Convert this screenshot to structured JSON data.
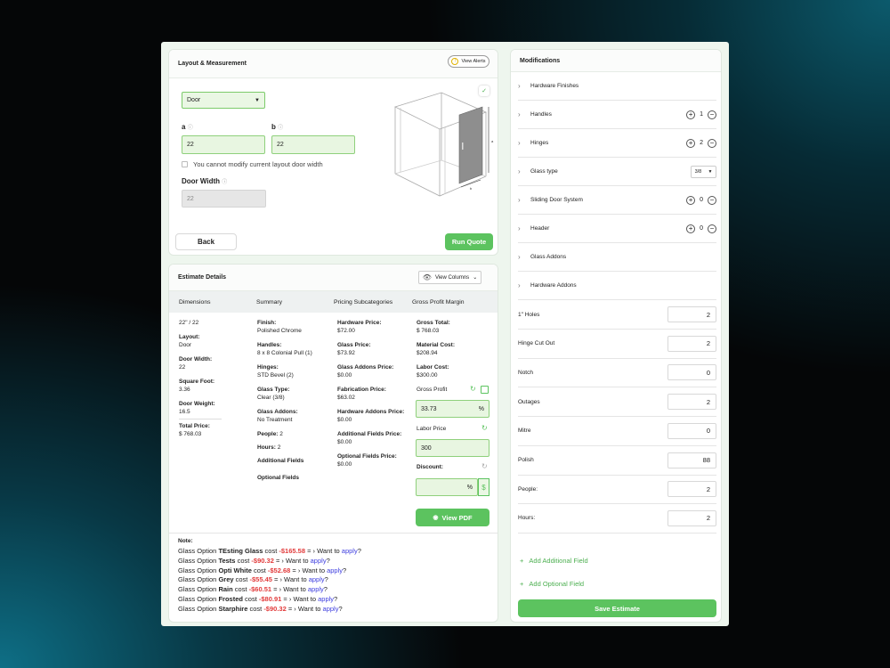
{
  "layout": {
    "title": "Layout & Measurement",
    "view_alerts": "View Alerts",
    "layout_select": "Door",
    "a_label": "a",
    "a_value": "22",
    "b_label": "b",
    "b_value": "22",
    "checkbox_label": "You cannot modify current layout door width",
    "door_width_label": "Door Width",
    "door_width_value": "22",
    "back": "Back",
    "run_quote": "Run Quote"
  },
  "estimate": {
    "title": "Estimate Details",
    "view_columns": "View Columns",
    "columns": [
      "Dimensions",
      "Summary",
      "Pricing Subcategories",
      "Gross Profit Margin"
    ],
    "dims": {
      "size": "22\" / 22",
      "layout_k": "Layout:",
      "layout_v": "Door",
      "dw_k": "Door Width:",
      "dw_v": "22",
      "sq_k": "Square Foot:",
      "sq_v": "3.36",
      "wt_k": "Door Weight:",
      "wt_v": "16.5",
      "tp_k": "Total Price:",
      "tp_v": "$ 768.03"
    },
    "summary": {
      "finish_k": "Finish:",
      "finish_v": "Polished Chrome",
      "handles_k": "Handles:",
      "handles_v": "8 x 8 Colonial Pull (1)",
      "hinges_k": "Hinges:",
      "hinges_v": "STD Bevel (2)",
      "glass_k": "Glass Type:",
      "glass_v": "Clear (3/8)",
      "addons_k": "Glass Addons:",
      "addons_v": "No Treatment",
      "people_k": "People:",
      "people_v": "2",
      "hours_k": "Hours:",
      "hours_v": "2",
      "additional": "Additional Fields",
      "optional": "Optional Fields"
    },
    "pricing": {
      "hw_k": "Hardware Price:",
      "hw_v": "$72.00",
      "gp_k": "Glass Price:",
      "gp_v": "$73.92",
      "gap_k": "Glass Addons Price:",
      "gap_v": "$0.00",
      "fab_k": "Fabrication Price:",
      "fab_v": "$63.02",
      "hap_k": "Hardware Addons Price:",
      "hap_v": "$0.00",
      "afp_k": "Additional Fields Price:",
      "afp_v": "$0.00",
      "ofp_k": "Optional Fields Price:",
      "ofp_v": "$0.00"
    },
    "gross": {
      "gt_k": "Gross Total:",
      "gt_v": "$ 768.03",
      "mc_k": "Material Cost:",
      "mc_v": "$208.94",
      "lc_k": "Labor Cost:",
      "lc_v": "$300.00",
      "gp_label": "Gross Profit",
      "gp_value": "33.73",
      "gp_unit": "%",
      "lp_label": "Labor Price",
      "lp_value": "300",
      "disc_label": "Discount:",
      "disc_value": "",
      "disc_pct": "%",
      "disc_dollar": "$",
      "view_pdf": "View PDF"
    },
    "note_title": "Note:",
    "notes": [
      {
        "pre": "Glass Option ",
        "name": "TEsting Glass",
        "mid": " cost ",
        "amount": "-$165.58",
        "post": " = › Want to ",
        "link": "apply",
        "end": "?"
      },
      {
        "pre": "Glass Option ",
        "name": "Tests",
        "mid": " cost ",
        "amount": "-$90.32",
        "post": " = › Want to ",
        "link": "apply",
        "end": "?"
      },
      {
        "pre": "Glass Option ",
        "name": "Opti White",
        "mid": " cost ",
        "amount": "-$52.68",
        "post": " = › Want to ",
        "link": "apply",
        "end": "?"
      },
      {
        "pre": "Glass Option ",
        "name": "Grey",
        "mid": " cost ",
        "amount": "-$55.45",
        "post": " = › Want to ",
        "link": "apply",
        "end": "?"
      },
      {
        "pre": "Glass Option ",
        "name": "Rain",
        "mid": " cost ",
        "amount": "-$60.51",
        "post": " = › Want to ",
        "link": "apply",
        "end": "?"
      },
      {
        "pre": "Glass Option ",
        "name": "Frosted",
        "mid": " cost ",
        "amount": "-$80.91",
        "post": " = › Want to ",
        "link": "apply",
        "end": "?"
      },
      {
        "pre": "Glass Option ",
        "name": "Starphire",
        "mid": " cost ",
        "amount": "-$90.32",
        "post": " = › Want to ",
        "link": "apply",
        "end": "?"
      }
    ]
  },
  "mods": {
    "title": "Modifications",
    "rows": [
      {
        "label": "Hardware Finishes"
      },
      {
        "label": "Handles",
        "count": "1"
      },
      {
        "label": "Hinges",
        "count": "2"
      },
      {
        "label": "Glass type",
        "select": "3/8"
      },
      {
        "label": "Sliding Door System",
        "count": "0"
      },
      {
        "label": "Header",
        "count": "0"
      },
      {
        "label": "Glass Addons"
      },
      {
        "label": "Hardware Addons"
      }
    ],
    "fields": [
      {
        "label": "1\" Holes",
        "value": "2"
      },
      {
        "label": "Hinge Cut Out",
        "value": "2"
      },
      {
        "label": "Notch",
        "value": "0"
      },
      {
        "label": "Outages",
        "value": "2"
      },
      {
        "label": "Mitre",
        "value": "0"
      },
      {
        "label": "Polish",
        "value": "88"
      },
      {
        "label": "People:",
        "value": "2"
      },
      {
        "label": "Hours:",
        "value": "2"
      }
    ],
    "add_additional": "Add Additional Field",
    "add_optional": "Add Optional Field",
    "save": "Save Estimate"
  },
  "colors": {
    "accent": "#5cc35f",
    "red": "#e23b3b",
    "link": "#3d3ddf"
  }
}
